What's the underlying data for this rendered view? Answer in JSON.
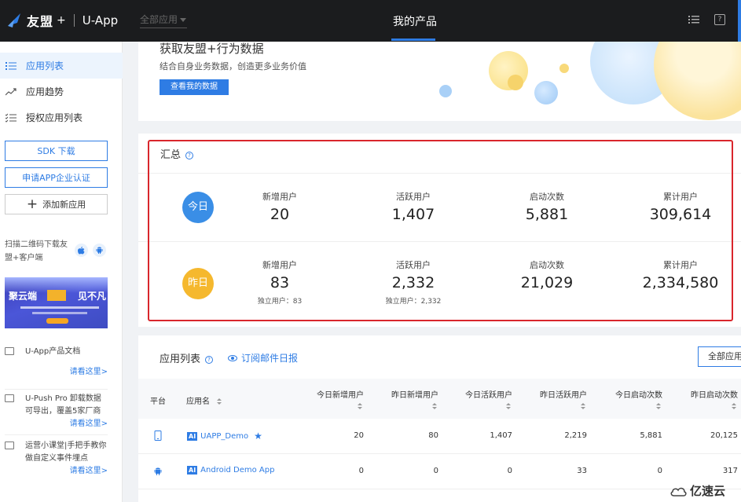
{
  "topbar": {
    "brand": "友盟",
    "brand_plus": "+",
    "product": "U-App",
    "app_selector": "全部应用",
    "nav_title": "我的产品",
    "icons": [
      "list-icon",
      "help-icon"
    ],
    "accent": "#2e7ce4"
  },
  "sidebar": {
    "items": [
      {
        "label": "应用列表",
        "icon": "list-icon",
        "active": true
      },
      {
        "label": "应用趋势",
        "icon": "trend-icon",
        "active": false
      },
      {
        "label": "授权应用列表",
        "icon": "checklist-icon",
        "active": false
      }
    ],
    "sdk_button": "SDK 下载",
    "cert_button": "申请APP企业认证",
    "add_app_button": "添加新应用",
    "qr_text": "扫描二维码下载友盟+客户端",
    "banner": {
      "left": "聚云端",
      "right": "见不凡"
    },
    "docs": [
      {
        "text": "U-App产品文档",
        "link": "请看这里>"
      },
      {
        "text": "U-Push Pro 卸载数据可导出，覆盖5家厂商",
        "link": "请看这里>"
      },
      {
        "text": "运营小课堂|手把手教你做自定义事件埋点",
        "link": "请看这里>"
      }
    ]
  },
  "promo": {
    "title": "获取友盟+行为数据",
    "desc": "结合自身业务数据，创造更多业务价值",
    "button": "查看我的数据"
  },
  "summary": {
    "title": "汇总",
    "today": {
      "badge": "今日",
      "new_users_label": "新增用户",
      "new_users": "20",
      "active_users_label": "活跃用户",
      "active_users": "1,407",
      "launches_label": "启动次数",
      "launches": "5,881",
      "total_users_label": "累计用户",
      "total_users": "309,614"
    },
    "yesterday": {
      "badge": "昨日",
      "new_users_label": "新增用户",
      "new_users": "83",
      "new_users_unique": "独立用户：83",
      "active_users_label": "活跃用户",
      "active_users": "2,332",
      "active_users_unique": "独立用户：2,332",
      "launches_label": "启动次数",
      "launches": "21,029",
      "total_users_label": "累计用户",
      "total_users": "2,334,580"
    },
    "colors": {
      "today": "#3a8ee6",
      "yesterday": "#f5b82e",
      "highlight": "#d9262c"
    }
  },
  "app_list": {
    "title": "应用列表",
    "subscribe": "订阅邮件日报",
    "all_apps_button": "全部应用",
    "columns": [
      "平台",
      "应用名",
      "今日新增用户",
      "昨日新增用户",
      "今日活跃用户",
      "昨日活跃用户",
      "今日启动次数",
      "昨日启动次数"
    ],
    "rows": [
      {
        "platform": "ios",
        "tag": "AI",
        "name": "UAPP_Demo",
        "starred": true,
        "values": [
          "20",
          "80",
          "1,407",
          "2,219",
          "5,881",
          "20,125"
        ]
      },
      {
        "platform": "android",
        "tag": "AI",
        "name": "Android Demo App",
        "starred": false,
        "values": [
          "0",
          "0",
          "0",
          "33",
          "0",
          "317"
        ]
      }
    ]
  },
  "watermark": "亿速云"
}
